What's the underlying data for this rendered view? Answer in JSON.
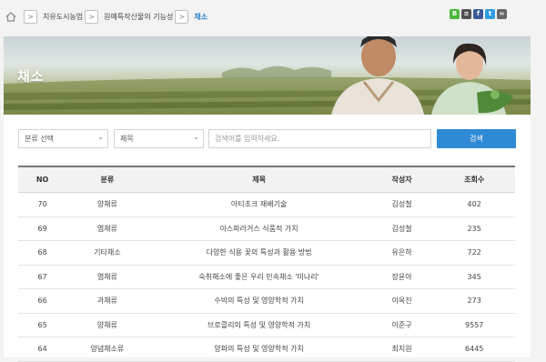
{
  "breadcrumb": {
    "items": [
      "치유도시농업",
      "원예특작산물의 기능성",
      "채소"
    ]
  },
  "social": {
    "icons": [
      "band-icon",
      "naver-icon",
      "facebook-icon",
      "twitter-icon",
      "link-icon"
    ],
    "colors": [
      "#4cb83d",
      "#515151",
      "#3b5998",
      "#2d9fe0",
      "#666666"
    ]
  },
  "banner": {
    "title": "채소"
  },
  "search": {
    "category_label": "분류 선택",
    "field_label": "제목",
    "keyword_placeholder": "검색어를 입력하세요.",
    "button_label": "검색",
    "button_color": "#2f8ad6"
  },
  "table": {
    "headers": {
      "no": "NO",
      "category": "분류",
      "title": "제목",
      "author": "작성자",
      "views": "조회수"
    },
    "rows": [
      {
        "no": "70",
        "category": "양채류",
        "title": "아티초크 재배기술",
        "author": "김성철",
        "views": "402"
      },
      {
        "no": "69",
        "category": "엽채류",
        "title": "아스파라거스 식품적 가치",
        "author": "김성철",
        "views": "235"
      },
      {
        "no": "68",
        "category": "기타채소",
        "title": "다양한 식용 꽃의 특성과 활용 방법",
        "author": "유은하",
        "views": "722"
      },
      {
        "no": "67",
        "category": "엽채류",
        "title": "숙취해소에 좋은 우리 민속채소 '미나리'",
        "author": "장윤아",
        "views": "345"
      },
      {
        "no": "66",
        "category": "과채류",
        "title": "수박의 특성 및 영양학적 가치",
        "author": "이옥진",
        "views": "273"
      },
      {
        "no": "65",
        "category": "양채류",
        "title": "브로콜리의 특성 및 영양학적 가치",
        "author": "이준구",
        "views": "9557"
      },
      {
        "no": "64",
        "category": "양념채소류",
        "title": "양파의 특성 및 영양학적 가치",
        "author": "최지원",
        "views": "6445"
      }
    ]
  }
}
